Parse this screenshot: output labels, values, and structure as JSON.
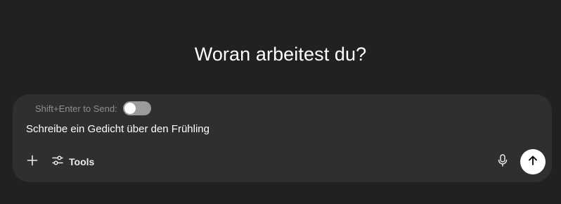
{
  "heading": "Woran arbeitest du?",
  "composer": {
    "shift_enter_label": "Shift+Enter to Send:",
    "shift_enter_enabled": false,
    "prompt_value": "Schreibe ein Gedicht über den Frühling",
    "tools_label": "Tools"
  },
  "icons": {
    "add": "plus-icon",
    "tools": "sliders-icon",
    "mic": "microphone-icon",
    "send": "arrow-up-icon"
  },
  "colors": {
    "background": "#212121",
    "composer": "#2f2f2f",
    "toggle_off": "#9b9b9b",
    "send_button": "#ffffff"
  }
}
